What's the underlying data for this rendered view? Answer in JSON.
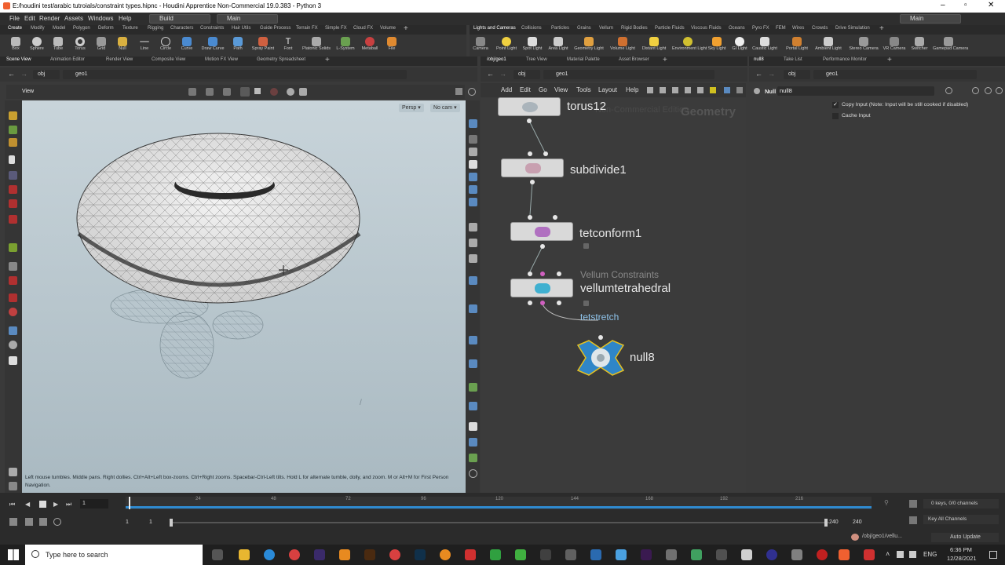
{
  "window": {
    "title": "E:/houdini test/arabic tutroials/constraint types.hipnc - Houdini Apprentice Non-Commercial 19.0.383 - Python 3"
  },
  "menu": [
    "File",
    "Edit",
    "Render",
    "Assets",
    "Windows",
    "Help"
  ],
  "desktop_build": "Build",
  "desktop_main": "Main",
  "desktop_main_right": "Main",
  "shelf_tabs": [
    "Create",
    "Modify",
    "Model",
    "Polygon",
    "Deform",
    "Texture",
    "Rigging",
    "Characters",
    "Constraints",
    "Hair Utils",
    "Guide Process",
    "Terrain FX",
    "Simple FX",
    "Cloud FX",
    "Volume"
  ],
  "shelf_tools": [
    "Box",
    "Sphere",
    "Tube",
    "Torus",
    "Grid",
    "Null",
    "Line",
    "Circle",
    "Curve",
    "Draw Curve",
    "Path",
    "Spray Paint",
    "Font",
    "Platonic Solids",
    "L-System",
    "Metaball",
    "File"
  ],
  "shelf2_tabs": [
    "Lights and Cameras",
    "Collisions",
    "Particles",
    "Grains",
    "Vellum",
    "Rigid Bodies",
    "Particle Fluids",
    "Viscous Fluids",
    "Oceans",
    "Pyro FX",
    "FEM",
    "Wires",
    "Crowds",
    "Drive Simulation"
  ],
  "shelf2_tools": [
    "Camera",
    "Point Light",
    "Spot Light",
    "Area Light",
    "Geometry Light",
    "Volume Light",
    "Distant Light",
    "Environment Light",
    "Sky Light",
    "GI Light",
    "Caustic Light",
    "Portal Light",
    "Ambient Light",
    "Stereo Camera",
    "VR Camera",
    "Switcher",
    "Gamepad Camera"
  ],
  "left_panel_tabs": [
    "Scene View",
    "Animation Editor",
    "Render View",
    "Composite View",
    "Motion FX View",
    "Geometry Spreadsheet"
  ],
  "mid_panel_tabs": [
    "/obj/geo1",
    "Tree View",
    "Material Palette",
    "Asset Browser"
  ],
  "right_panel_tabs": [
    "null8",
    "Take List",
    "Performance Monitor"
  ],
  "path": {
    "obj": "obj",
    "geo": "geo1"
  },
  "viewport": {
    "label": "View",
    "persp": "Persp",
    "cam": "No cam",
    "hint": "Left mouse tumbles. Middle pans. Right dollies. Ctrl+Alt+Left box-zooms. Ctrl+Right zooms. Spacebar-Ctrl-Left tilts. Hold L for alternate tumble, dolly, and zoom.    M or Alt+M for First Person Navigation."
  },
  "network": {
    "menu": [
      "Add",
      "Edit",
      "Go",
      "View",
      "Tools",
      "Layout",
      "Help"
    ],
    "watermark_mode": "Geometry",
    "watermark_edition": "Non-Commercial Edition",
    "nodes": [
      {
        "name": "torus12"
      },
      {
        "name": "subdivide1"
      },
      {
        "name": "tetconform1"
      },
      {
        "name": "vellumtetrahedral",
        "subtitle": "Vellum Constraints",
        "output": "tetstretch"
      },
      {
        "name": "null8"
      }
    ]
  },
  "params": {
    "type": "Null",
    "name": "null8",
    "copy_input": "Copy Input (Note: Input will be still cooked if disabled)",
    "copy_input_checked": true,
    "cache_input": "Cache Input",
    "cache_input_checked": false
  },
  "timeline": {
    "ticks": [
      "24",
      "48",
      "72",
      "96",
      "120",
      "144",
      "168",
      "192",
      "216"
    ],
    "current_frame": "1",
    "start": "1",
    "start2": "1",
    "end": "240",
    "end2": "240",
    "keys": "0 keys, 0/0 channels",
    "key_all": "Key All Channels"
  },
  "status": {
    "path": "/obj/geo1/vellu...",
    "update": "Auto Update"
  },
  "taskbar": {
    "search": "Type here to search",
    "lang": "ENG",
    "time": "6:36 PM",
    "date": "12/28/2021"
  }
}
